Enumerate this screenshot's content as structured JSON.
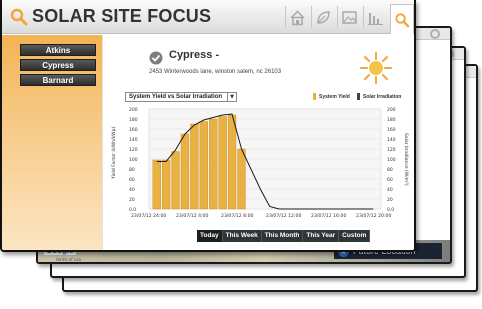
{
  "app": {
    "title": "SOLAR SITE FOCUS"
  },
  "header_icons": [
    "home-icon",
    "leaf-icon",
    "image-icon",
    "bar-chart-icon",
    "search-icon"
  ],
  "sidebar": {
    "sites": [
      {
        "label": "Atkins"
      },
      {
        "label": "Cypress"
      },
      {
        "label": "Barnard"
      }
    ]
  },
  "site": {
    "name": "Cypress -",
    "address": "2453 Winterwoods lane, winston salem, nc 26103"
  },
  "chart_selector": {
    "selected": "System Yield vs Solar Irradiation"
  },
  "legend": {
    "yield": "System Yield",
    "irradiation": "Solar Irradiation"
  },
  "colors": {
    "accent_orange": "#f3a53a",
    "bar_fill": "#e9b042",
    "line": "#1a1a1a",
    "dark_button": "#2f3437"
  },
  "range_buttons": {
    "today": "Today",
    "week": "This Week",
    "month": "This Month",
    "year": "This Year",
    "custom": "Custom"
  },
  "background": {
    "map_logo": "Google",
    "map_logo_sub": "terms of use",
    "future_location": "Future Location"
  },
  "chart_data": {
    "type": "bar",
    "title": "",
    "ylabel_left": "Yield Factor (kWh/kWp)",
    "ylabel_right": "Solar Irradiance (W/m²)",
    "ylim": [
      0,
      200
    ],
    "yticks_left": [
      "200",
      "180",
      "160",
      "140",
      "120",
      "100",
      "80",
      "60",
      "40",
      "20",
      "0.0"
    ],
    "yticks_right": [
      "200",
      "180",
      "160",
      "140",
      "120",
      "100",
      "80",
      "60",
      "40",
      "20",
      "0.0"
    ],
    "x_tick_labels": [
      "23/07/12 24:00",
      "23/07/12 4:00",
      "23/07/12 8:00",
      "23/07/12 12:00",
      "23/07/12 16:00",
      "23/07/12 20:00"
    ],
    "grid": true,
    "series": [
      {
        "name": "System Yield",
        "values": [
          98,
          98,
          115,
          150,
          170,
          175,
          180,
          185,
          188,
          120,
          0,
          0,
          0,
          0,
          0,
          0,
          0,
          0,
          0,
          0,
          0,
          0,
          0,
          0
        ]
      },
      {
        "name": "Solar Irradiation",
        "values": [
          95,
          95,
          118,
          150,
          168,
          178,
          183,
          188,
          190,
          120,
          80,
          40,
          5,
          0,
          0,
          0,
          0,
          0,
          0,
          0,
          0,
          0,
          0,
          0
        ]
      }
    ]
  }
}
